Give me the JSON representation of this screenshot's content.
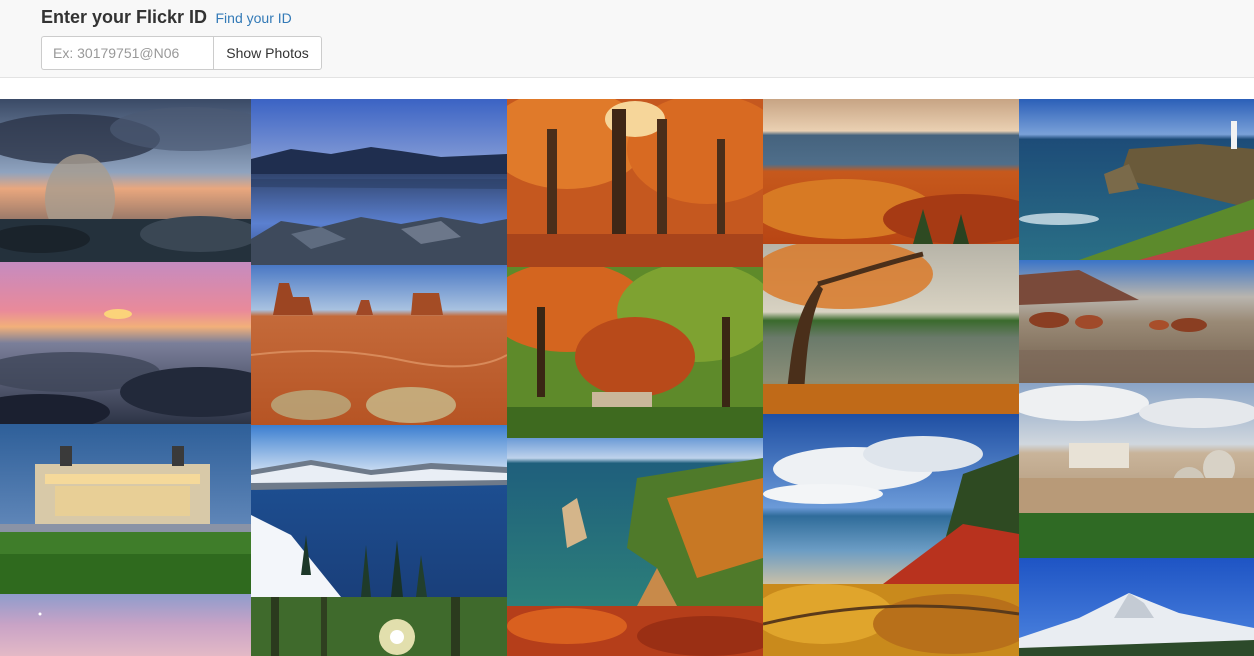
{
  "header": {
    "title": "Enter your Flickr ID",
    "find_link": "Find your ID",
    "input_placeholder": "Ex: 30179751@N06",
    "input_value": "",
    "button_label": "Show Photos"
  },
  "gallery": {
    "columns": [
      {
        "photos": [
          {
            "subject": "ocean-wave-storm"
          },
          {
            "subject": "pink-sunset-rocky-coast"
          },
          {
            "subject": "vittoriano-monument-dusk"
          },
          {
            "subject": "pastel-sky"
          }
        ]
      },
      {
        "photos": [
          {
            "subject": "mountain-lake-reflection"
          },
          {
            "subject": "monument-valley"
          },
          {
            "subject": "crater-lake-snow"
          },
          {
            "subject": "forest-sunburst"
          }
        ]
      },
      {
        "photos": [
          {
            "subject": "autumn-forest"
          },
          {
            "subject": "autumn-garden-bridge"
          },
          {
            "subject": "lake-cliffs-autumn"
          },
          {
            "subject": "red-autumn-leaves"
          }
        ]
      },
      {
        "photos": [
          {
            "subject": "autumn-hills-lake"
          },
          {
            "subject": "autumn-tree-lake"
          },
          {
            "subject": "lake-shore-clouds"
          },
          {
            "subject": "golden-autumn-trees"
          }
        ]
      },
      {
        "photos": [
          {
            "subject": "lighthouse-cliffs"
          },
          {
            "subject": "beach-sea-stacks"
          },
          {
            "subject": "city-domes-panorama"
          },
          {
            "subject": "snowy-mountain"
          }
        ]
      }
    ]
  }
}
